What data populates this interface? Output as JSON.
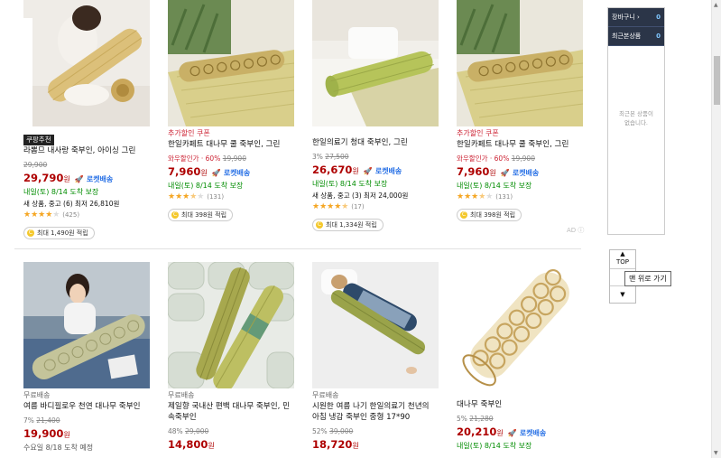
{
  "products": [
    {
      "badge": "쿠팡추천",
      "promo": "",
      "name": "라뽐므 내사랑 죽부인, 아이싱 그린",
      "discount": "",
      "original_price": "29,900",
      "price": "29,790",
      "won": "원",
      "rocket": "로켓배송",
      "delivery": "내일(토) 8/14 도착 보장",
      "used_text": "새 상품, 중고 (6) 최저 26,810원",
      "rating": 4,
      "review_count": "(425)",
      "coupon": "최대 1,490원 적립"
    },
    {
      "badge": "",
      "promo": "추가할인 쿠폰",
      "name": "한일카페트 대나무 쿨 죽부인, 그린",
      "discount": "와우할인가 · 60%",
      "original_price": "19,900",
      "price": "7,960",
      "won": "원",
      "rocket": "로켓배송",
      "delivery": "내일(토) 8/14 도착 보장",
      "used_text": "",
      "rating": 3.5,
      "review_count": "(131)",
      "coupon": "최대 398원 적립"
    },
    {
      "badge": "",
      "promo": "",
      "name": "한일의료기 청대 죽부인, 그린",
      "discount": "3%",
      "original_price": "27,500",
      "price": "26,670",
      "won": "원",
      "rocket": "로켓배송",
      "delivery": "내일(토) 8/14 도착 보장",
      "used_text": "새 상품, 중고 (3) 최저 24,000원",
      "rating": 4.5,
      "review_count": "(17)",
      "coupon": "최대 1,334원 적립"
    },
    {
      "badge": "",
      "promo": "추가할인 쿠폰",
      "name": "한일카페트 대나무 쿨 죽부인, 그린",
      "discount": "와우할인가 · 60%",
      "original_price": "19,900",
      "price": "7,960",
      "won": "원",
      "rocket": "로켓배송",
      "delivery": "내일(토) 8/14 도착 보장",
      "used_text": "",
      "rating": 3.5,
      "review_count": "(131)",
      "coupon": "최대 398원 적립"
    },
    {
      "badge": "",
      "promo": "무료배송",
      "name": "여름 바디필로우 천연 대나무 죽부인",
      "discount": "7%",
      "original_price": "21,400",
      "price": "19,900",
      "won": "원",
      "rocket": "",
      "delivery": "수요일 8/18 도착 예정",
      "used_text": "",
      "rating": 0,
      "review_count": "",
      "coupon": ""
    },
    {
      "badge": "",
      "promo": "무료배송",
      "name": "제일향 국내산 편백 대나무 죽부인, 민속죽부인",
      "discount": "48%",
      "original_price": "29,000",
      "price": "14,800",
      "won": "원",
      "rocket": "",
      "delivery": "",
      "used_text": "",
      "rating": 0,
      "review_count": "",
      "coupon": ""
    },
    {
      "badge": "",
      "promo": "무료배송",
      "name": "시원한 여름 나기 한일의료기 천년의 아침 냉감 죽부인 중형 17*90",
      "discount": "52%",
      "original_price": "39,000",
      "price": "18,720",
      "won": "원",
      "rocket": "",
      "delivery": "",
      "used_text": "",
      "rating": 0,
      "review_count": "",
      "coupon": ""
    },
    {
      "badge": "",
      "promo": "",
      "name": "대나무 죽부인",
      "discount": "5%",
      "original_price": "21,280",
      "price": "20,210",
      "won": "원",
      "rocket": "로켓배송",
      "delivery": "내일(토) 8/14 도착 보장",
      "used_text": "",
      "rating": 0,
      "review_count": "",
      "coupon": ""
    }
  ],
  "ad_label": "AD",
  "sidebar": {
    "cart_label": "장바구니 ›",
    "cart_count": "0",
    "recent_label": "최근본상품",
    "recent_count": "0",
    "empty_line1": "최근본 상품이",
    "empty_line2": "없습니다."
  },
  "top_button": {
    "label": "TOP",
    "tooltip": "맨 위로 가기"
  },
  "colors": {
    "price": "#ae0000",
    "rocket": "#2d74e6",
    "delivery": "#008c00",
    "promo": "#cc2233"
  }
}
